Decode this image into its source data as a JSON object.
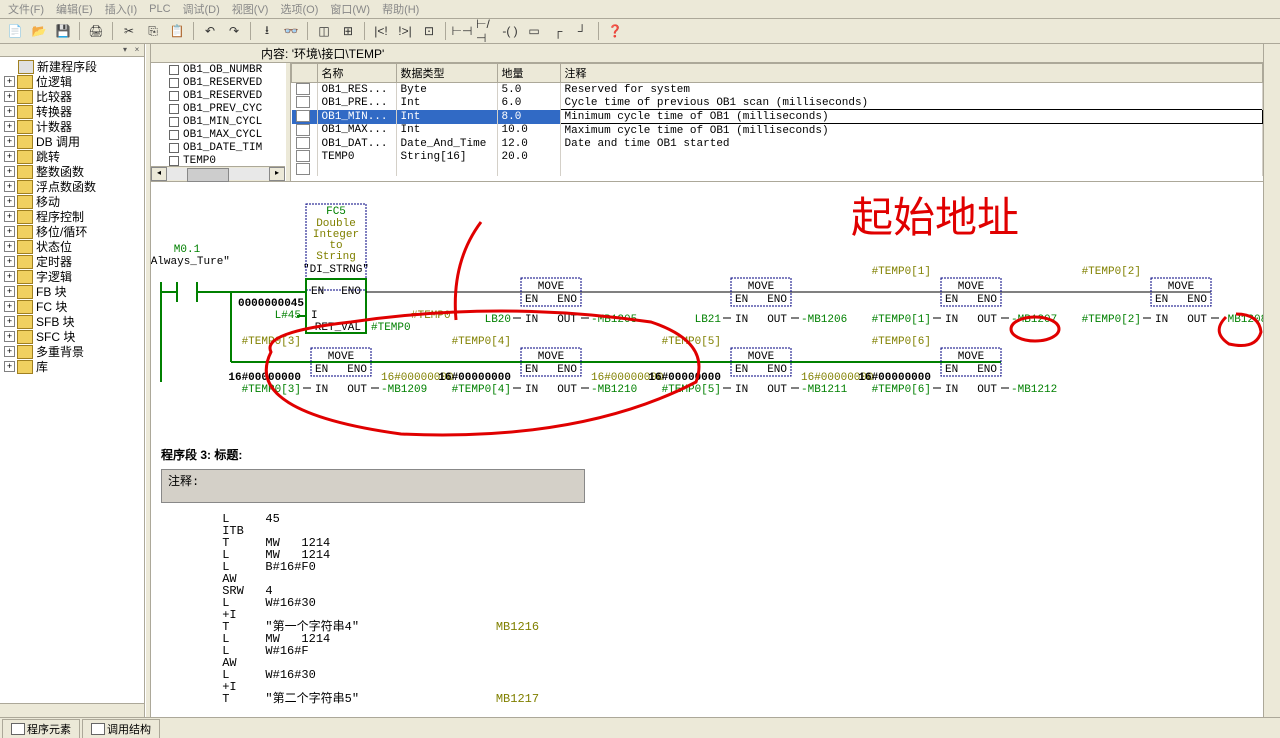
{
  "menu": {
    "items": [
      "文件(F)",
      "编辑(E)",
      "插入(I)",
      "PLC",
      "调试(D)",
      "视图(V)",
      "选项(O)",
      "窗口(W)",
      "帮助(H)"
    ]
  },
  "path": {
    "label": "内容:",
    "value": "'环境\\接口\\TEMP'"
  },
  "sidebar": {
    "header": "新建程序段",
    "items": [
      {
        "label": "位逻辑"
      },
      {
        "label": "比较器"
      },
      {
        "label": "转换器"
      },
      {
        "label": "计数器"
      },
      {
        "label": "DB 调用"
      },
      {
        "label": "跳转"
      },
      {
        "label": "整数函数"
      },
      {
        "label": "浮点数函数"
      },
      {
        "label": "移动"
      },
      {
        "label": "程序控制"
      },
      {
        "label": "移位/循环"
      },
      {
        "label": "状态位"
      },
      {
        "label": "定时器"
      },
      {
        "label": "字逻辑"
      },
      {
        "label": "FB 块"
      },
      {
        "label": "FC 块"
      },
      {
        "label": "SFB 块"
      },
      {
        "label": "SFC 块"
      },
      {
        "label": "多重背景"
      },
      {
        "label": "库"
      }
    ]
  },
  "obtree": {
    "items": [
      "OB1_OB_NUMBR",
      "OB1_RESERVED",
      "OB1_RESERVED",
      "OB1_PREV_CYC",
      "OB1_MIN_CYCL",
      "OB1_MAX_CYCL",
      "OB1_DATE_TIM",
      "TEMP0"
    ]
  },
  "vartable": {
    "headers": {
      "name": "名称",
      "type": "数据类型",
      "addr": "地量",
      "comment": "注释"
    },
    "rows": [
      {
        "name": "OB1_RES...",
        "type": "Byte",
        "addr": "5.0",
        "comment": "Reserved for system"
      },
      {
        "name": "OB1_PRE...",
        "type": "Int",
        "addr": "6.0",
        "comment": "Cycle time of previous OB1 scan (milliseconds)"
      },
      {
        "name": "OB1_MIN...",
        "type": "Int",
        "addr": "8.0",
        "comment": "Minimum cycle time of OB1 (milliseconds)",
        "sel": true
      },
      {
        "name": "OB1_MAX...",
        "type": "Int",
        "addr": "10.0",
        "comment": "Maximum cycle time of OB1 (milliseconds)"
      },
      {
        "name": "OB1_DAT...",
        "type": "Date_And_Time",
        "addr": "12.0",
        "comment": "Date and time OB1 started"
      },
      {
        "name": "TEMP0",
        "type": "String[16]",
        "addr": "20.0",
        "comment": ""
      }
    ]
  },
  "ladder": {
    "contact": {
      "addr": "M0.1",
      "name": "\"Always_Ture\""
    },
    "fc5": {
      "title": "FC5",
      "desc1": "Double",
      "desc2": "Integer",
      "desc3": "to",
      "desc4": "String",
      "name": "\"DI_STRNG\"",
      "en": "EN",
      "eno": "ENO",
      "in": "I",
      "in_val": "L#45",
      "in_const": "0000000045",
      "retval": "RET_VAL",
      "ret_out": "#TEMP0"
    },
    "temp0": "#TEMP0",
    "moves": [
      {
        "in": "LB20",
        "out": "MB1205"
      },
      {
        "in": "LB21",
        "out": "MB1206"
      },
      {
        "lbl": "#TEMP0[1]",
        "in": "#TEMP0[1]",
        "out": "MB1207"
      },
      {
        "lbl": "#TEMP0[2]",
        "in": "#TEMP0[2]",
        "out": "MB1208"
      },
      {
        "hex": "16#00000000",
        "lbl": "#TEMP0[3]",
        "in": "#TEMP0[3]",
        "out": "MB1209"
      },
      {
        "hex": "16#00000000",
        "lbl": "#TEMP0[4]",
        "in": "#TEMP0[4]",
        "out": "MB1210"
      },
      {
        "hex": "16#00000000",
        "lbl": "#TEMP0[5]",
        "in": "#TEMP0[5]",
        "out": "MB1211"
      },
      {
        "hex": "16#00000000",
        "lbl": "#TEMP0[6]",
        "in": "#TEMP0[6]",
        "out": "MB1212"
      }
    ],
    "move_title": "MOVE",
    "en": "EN",
    "eno": "ENO",
    "in_lbl": "IN",
    "out_lbl": "OUT",
    "hex_olive": "16#00000000"
  },
  "segment": {
    "header": "程序段  3: 标题:",
    "comment_label": "注释:"
  },
  "stl": {
    "lines": [
      "L     45",
      "ITB",
      "T     MW   1214",
      "L     MW   1214",
      "L     B#16#F0",
      "AW",
      "SRW   4",
      "L     W#16#30",
      "+I",
      "T     \"第一个字符串4\"                   MB1216",
      "L     MW   1214",
      "L     W#16#F",
      "AW",
      "L     W#16#30",
      "+I",
      "T     \"第二个字符串5\"                   MB1217"
    ]
  },
  "tabs": {
    "t1": "程序元素",
    "t2": "调用结构"
  },
  "annotation": "起始地址"
}
